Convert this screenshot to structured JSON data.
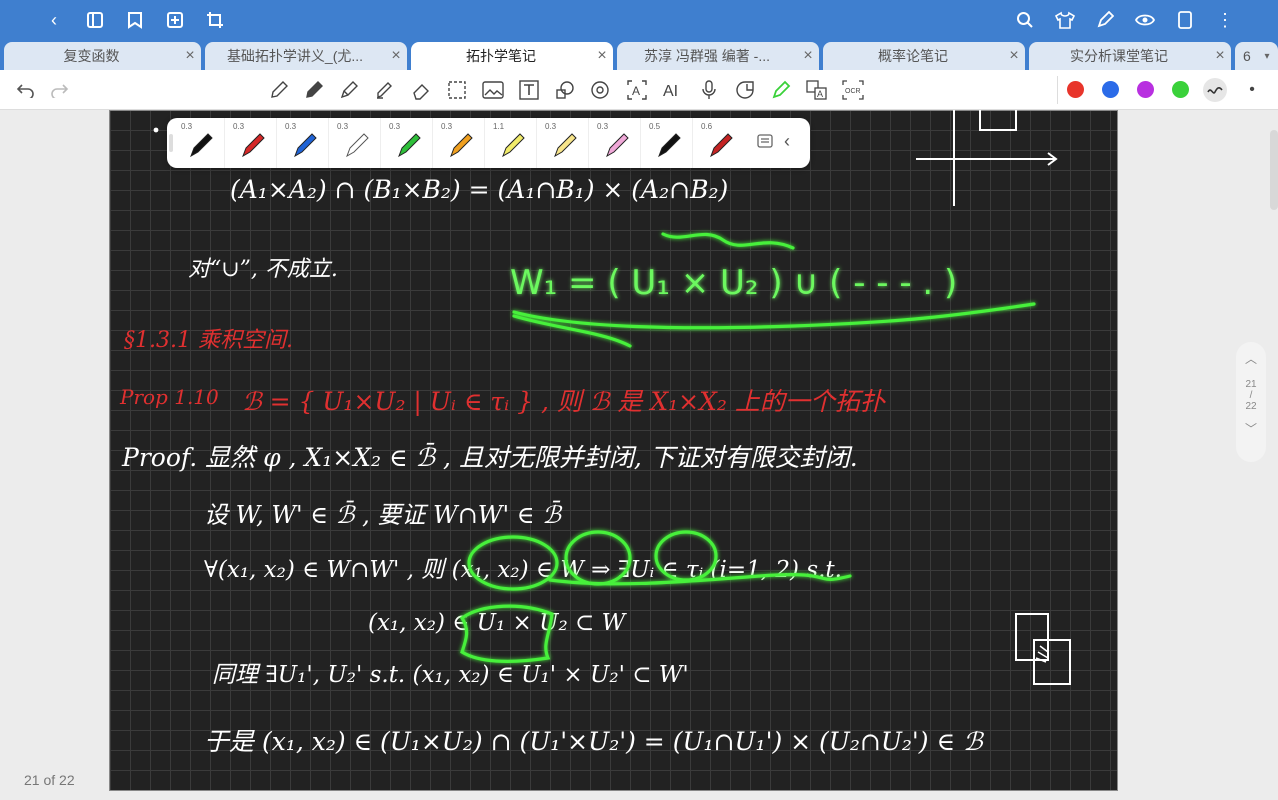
{
  "top_toolbar": {
    "icons": [
      "back-icon",
      "sidebar-icon",
      "bookmark-icon",
      "add-page-icon",
      "crop-icon",
      "search-icon",
      "shirt-icon",
      "pen-icon",
      "eye-icon",
      "page-icon",
      "more-icon"
    ]
  },
  "tabs": [
    {
      "label": "复变函数",
      "active": false
    },
    {
      "label": "基础拓扑学讲义_(尤...",
      "active": false
    },
    {
      "label": "拓扑学笔记",
      "active": true
    },
    {
      "label": "苏淳 冯群强 编著 -...",
      "active": false
    },
    {
      "label": "概率论笔记",
      "active": false
    },
    {
      "label": "实分析课堂笔记",
      "active": false
    },
    {
      "label": "6",
      "active": false
    }
  ],
  "tools": [
    "undo-icon",
    "redo-icon",
    "pencil-icon",
    "pen-icon",
    "fountain-pen-icon",
    "highlighter-icon",
    "eraser-icon",
    "lasso-icon",
    "image-icon",
    "text-icon",
    "shape-icon",
    "tape-icon",
    "text-recognition-icon",
    "ai-icon",
    "microphone-icon",
    "sticker-icon",
    "laser-icon",
    "translate-icon",
    "ocr-icon"
  ],
  "colors": [
    "#e8352b",
    "#2b6be8",
    "#b830e0",
    "#3ad13a"
  ],
  "pens": [
    {
      "size": "0.3",
      "color": "#111111"
    },
    {
      "size": "0.3",
      "color": "#d62828"
    },
    {
      "size": "0.3",
      "color": "#1f63d6"
    },
    {
      "size": "0.3",
      "color": "#ffffff"
    },
    {
      "size": "0.3",
      "color": "#2fbf3a"
    },
    {
      "size": "0.3",
      "color": "#f0a020"
    },
    {
      "size": "1.1",
      "color": "#f2ec6a"
    },
    {
      "size": "0.3",
      "color": "#f7e48a"
    },
    {
      "size": "0.3",
      "color": "#f0a8d8"
    },
    {
      "size": "0.5",
      "color": "#111111"
    },
    {
      "size": "0.6",
      "color": "#c42323"
    }
  ],
  "pager": {
    "current": "21",
    "sep": "/",
    "total": "22"
  },
  "footer": {
    "page_label": "21 of 22"
  },
  "notes": {
    "line1": "(A₁×A₂) ∩ (B₁×B₂) = (A₁∩B₁) × (A₂∩B₂)",
    "line2": "对“∪”, 不成立.",
    "green_formula": "W₁ = ( U₁ × U₂ ) ∪ ( - - - . )",
    "section": "§1.3.1  乘积空间.",
    "prop_label": "Prop 1.10",
    "prop_text": "ℬ = { U₁×U₂ | Uᵢ ∈ τᵢ } , 则 ℬ 是 X₁×X₂ 上的一个拓扑",
    "proof1": "Proof.  显然 φ , X₁×X₂ ∈ ℬ̄ , 且对无限并封闭, 下证对有限交封闭.",
    "proof2": "设 W, W' ∈ ℬ̄ , 要证 W∩W' ∈ ℬ̄",
    "proof3": "∀(x₁, x₂) ∈ W∩W' , 则 (x₁, x₂) ∈ W ⇒ ∃Uᵢ ∈ τᵢ (i=1, 2)  s.t.",
    "proof4": "(x₁, x₂) ∈ U₁ × U₂ ⊂ W",
    "proof5": "同理 ∃U₁', U₂'    s.t.  (x₁, x₂) ∈ U₁' × U₂' ⊂ W'",
    "proof6": "于是 (x₁, x₂) ∈ (U₁×U₂) ∩ (U₁'×U₂') = (U₁∩U₁') × (U₂∩U₂') ∈ ℬ"
  }
}
